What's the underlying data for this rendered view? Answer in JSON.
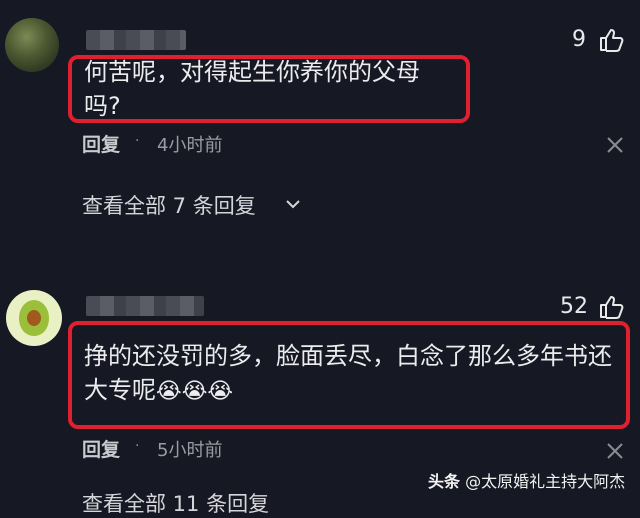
{
  "comments": [
    {
      "likes": "9",
      "text": "何苦呢，对得起生你养你的父母吗?",
      "reply_label": "回复",
      "separator": "·",
      "time": "4小时前",
      "view_replies": "查看全部 7 条回复"
    },
    {
      "likes": "52",
      "text_line1": "挣的还没罚的多，脸面丢尽，白念了那么多年书还",
      "text_line2": "大专呢",
      "emoji": "😭😭😭",
      "reply_label": "回复",
      "separator": "·",
      "time": "5小时前",
      "view_replies": "查看全部 11 条回复"
    }
  ],
  "watermark": {
    "brand": "头条",
    "handle": "@太原婚礼主持大阿杰"
  },
  "colors": {
    "background": "#161823",
    "highlight_border": "#e0202e"
  }
}
